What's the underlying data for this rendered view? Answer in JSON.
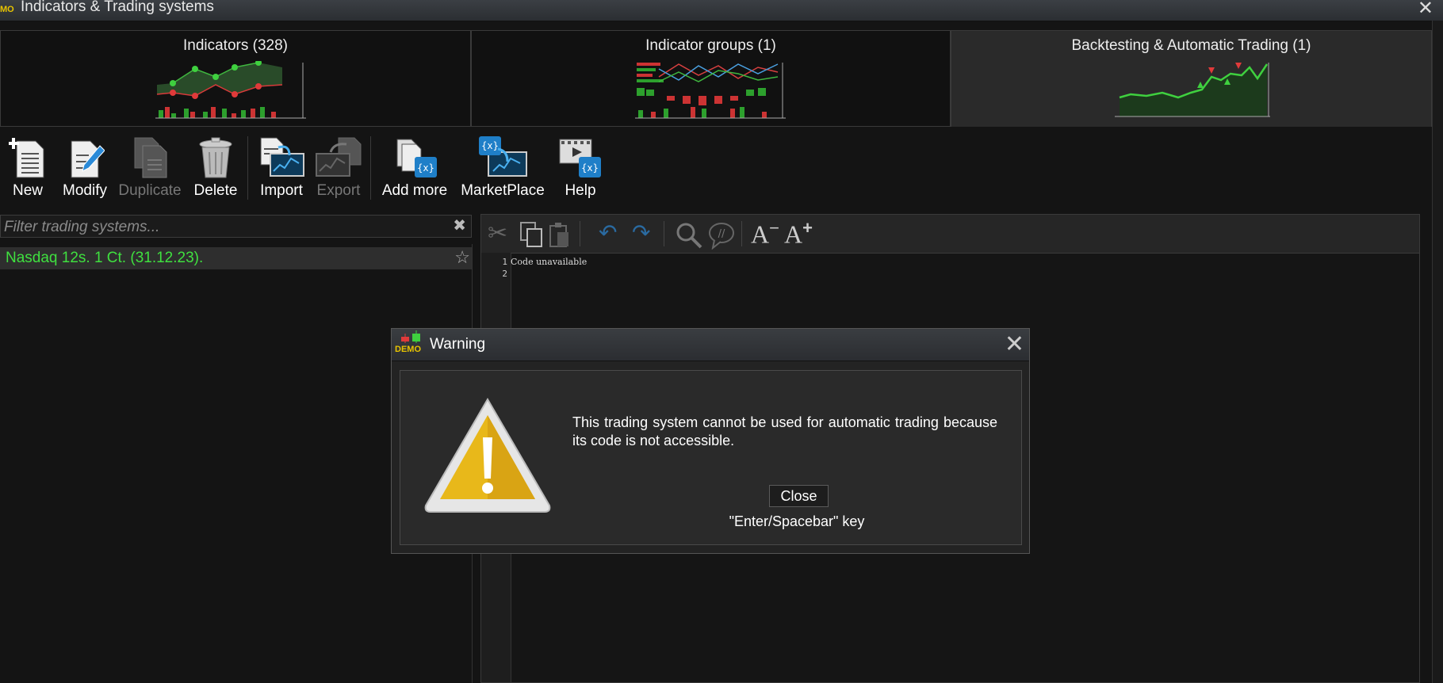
{
  "window": {
    "title": "Indicators & Trading systems",
    "demo_badge": "MO"
  },
  "tabs": [
    {
      "label": "Indicators (328)"
    },
    {
      "label": "Indicator groups (1)"
    },
    {
      "label": "Backtesting & Automatic Trading (1)"
    }
  ],
  "toolbar": {
    "new": "New",
    "modify": "Modify",
    "duplicate": "Duplicate",
    "delete": "Delete",
    "import": "Import",
    "export": "Export",
    "add_more": "Add more",
    "marketplace": "MarketPlace",
    "help": "Help"
  },
  "filter": {
    "placeholder": "Filter trading systems..."
  },
  "systems": [
    {
      "name": "Nasdaq 12s. 1 Ct. (31.12.23)."
    }
  ],
  "editor": {
    "lines": [
      "1",
      "2"
    ],
    "code": "Code unavailable"
  },
  "dialog": {
    "demo_badge": "DEMO",
    "title": "Warning",
    "message": "This trading system cannot be used for automatic trading because its code is not accessible.",
    "close_label": "Close",
    "hint": "\"Enter/Spacebar\" key"
  },
  "colors": {
    "accent_green": "#3fe03f",
    "warning_yellow": "#e8c400",
    "icon_blue": "#1f7fc8"
  }
}
